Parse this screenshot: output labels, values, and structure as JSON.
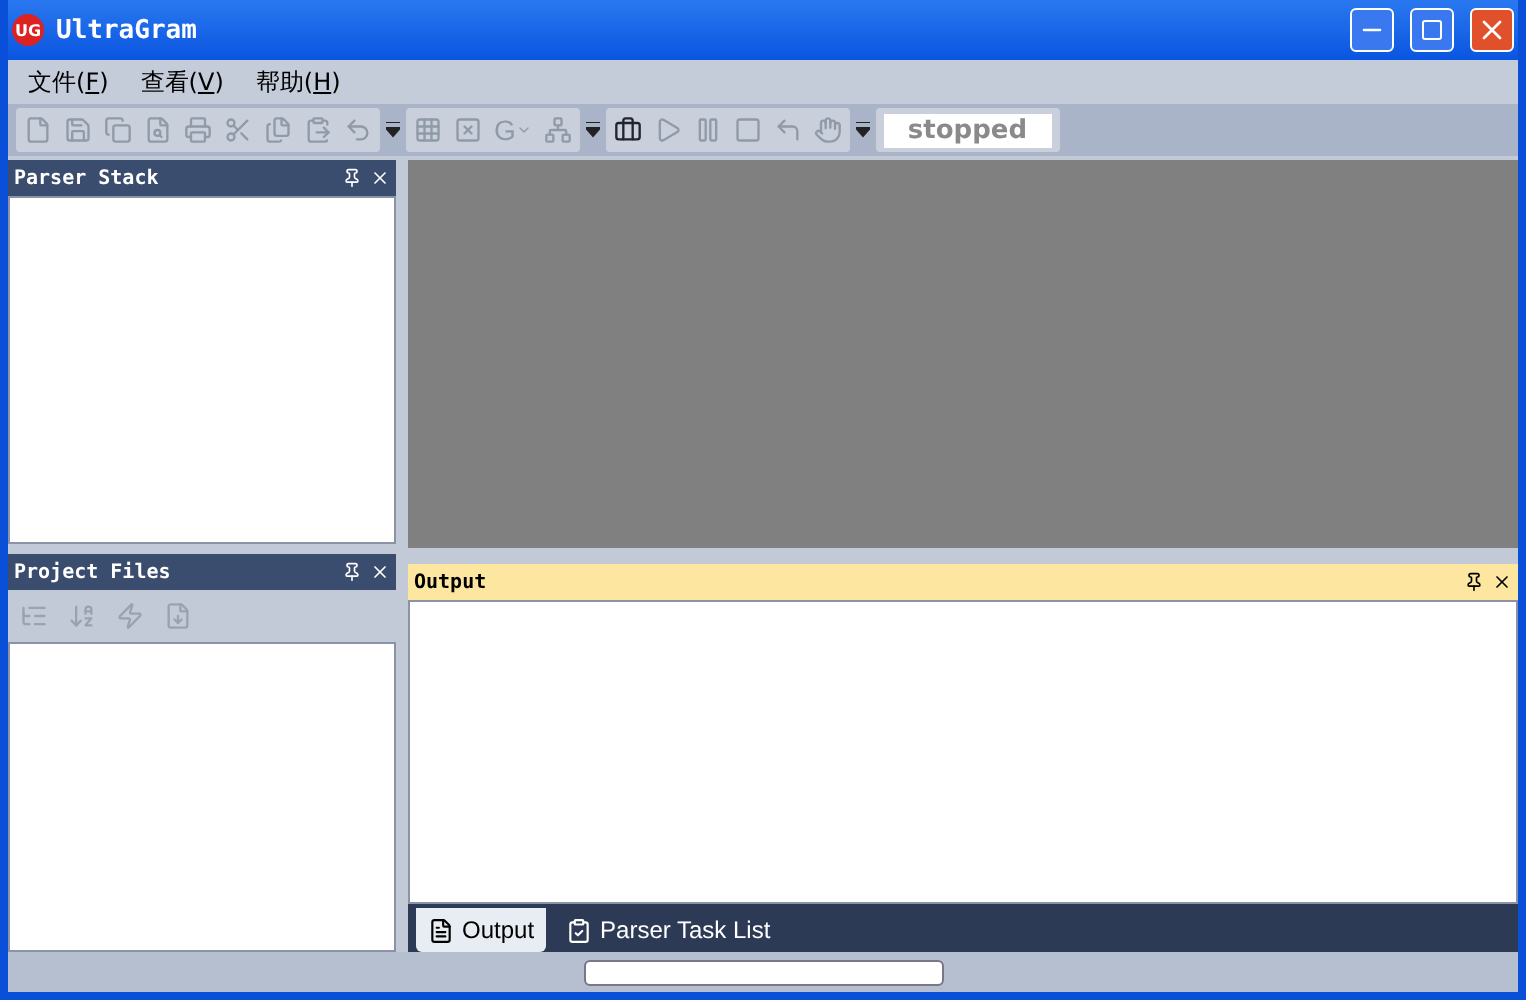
{
  "window": {
    "title": "UltraGram",
    "logo": "UG"
  },
  "menu": [
    {
      "before": "文件(",
      "key": "F",
      "after": ")"
    },
    {
      "before": "查看(",
      "key": "V",
      "after": ")"
    },
    {
      "before": "帮助(",
      "key": "H",
      "after": ")"
    }
  ],
  "toolbar": {
    "letter": "G",
    "status": "stopped"
  },
  "panels": {
    "parser_stack": {
      "title": "Parser Stack"
    },
    "project_files": {
      "title": "Project Files"
    },
    "output": {
      "title": "Output"
    }
  },
  "output_tabs": [
    {
      "label": "Output",
      "selected": true,
      "kind": "list"
    },
    {
      "label": "Parser Task List",
      "selected": false,
      "kind": "check"
    }
  ]
}
